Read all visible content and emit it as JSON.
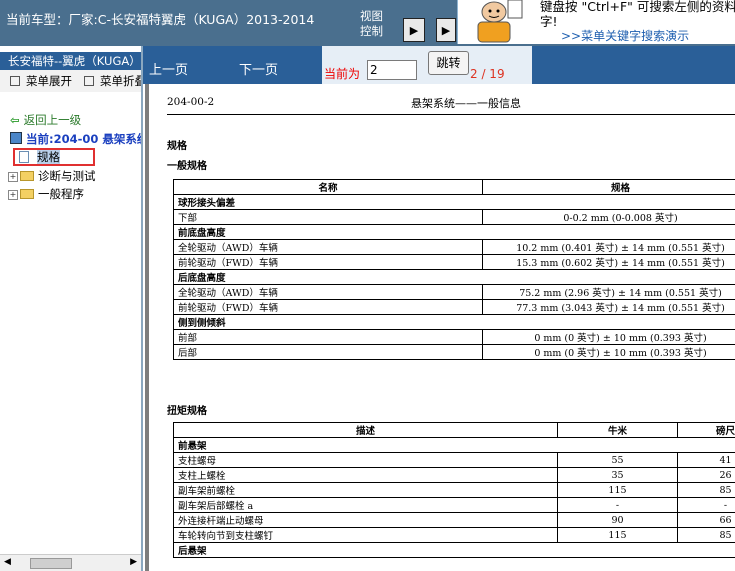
{
  "header": {
    "vehicle_label": "当前车型：厂家:C-长安福特翼虎（KUGA）2013-2014",
    "view_control_line1": "视图",
    "view_control_line2": "控制",
    "tip_line1": "键盘按 \"Ctrl+F\" 可搜索左侧的资料",
    "tip_line2": "字!",
    "tip_link": ">>菜单关键字搜索演示"
  },
  "sidebar": {
    "title": "长安福特--翼虎（KUGA）",
    "expand_menu": "菜单展开",
    "collapse_menu": "菜单折叠",
    "back": "返回上一级",
    "current": "当前:204-00 悬架系统",
    "items": [
      {
        "label": "规格",
        "selected": true
      },
      {
        "label": "诊断与测试"
      },
      {
        "label": "一般程序"
      }
    ]
  },
  "toolbar": {
    "prev": "上一页",
    "next": "下一页",
    "current_label": "当前为",
    "page_value": "2",
    "jump": "跳转",
    "page_count": "2 / 19"
  },
  "document": {
    "number": "204-00-2",
    "header": "悬架系统——一般信息",
    "section": "规格",
    "subsection1": "一般规格",
    "table1": {
      "headers": [
        "名称",
        "规格"
      ],
      "rows": [
        {
          "section": "球形接头偏差"
        },
        {
          "name": "下部",
          "spec": "0-0.2 mm (0-0.008 英寸)"
        },
        {
          "section": "前底盘高度"
        },
        {
          "name": "全轮驱动（AWD）车辆",
          "spec": "10.2 mm (0.401 英寸) ± 14 mm (0.551  英寸)"
        },
        {
          "name": "前轮驱动（FWD）车辆",
          "spec": "15.3 mm (0.602 英寸) ± 14 mm (0.551 英寸)"
        },
        {
          "section": "后底盘高度"
        },
        {
          "name": "全轮驱动（AWD）车辆",
          "spec": "75.2 mm (2.96 英寸) ± 14 mm (0.551 英寸)"
        },
        {
          "name": "前轮驱动（FWD）车辆",
          "spec": "77.3 mm (3.043 英寸) ± 14 mm (0.551 英寸)"
        },
        {
          "section": "侧到侧倾斜"
        },
        {
          "name": "前部",
          "spec": "0 mm (0 英寸) ± 10 mm (0.393 英寸)"
        },
        {
          "name": "后部",
          "spec": "0 mm (0 英寸) ± 10 mm (0.393 英寸)"
        }
      ]
    },
    "subsection2": "扭矩规格",
    "table2": {
      "headers": [
        "描述",
        "牛米",
        "磅尺"
      ],
      "rows": [
        {
          "section": "前悬架"
        },
        {
          "desc": "支柱螺母",
          "nm": "55",
          "lbft": "41"
        },
        {
          "desc": "支柱上螺栓",
          "nm": "35",
          "lbft": "26"
        },
        {
          "desc": "副车架前螺栓",
          "nm": "115",
          "lbft": "85"
        },
        {
          "desc": "副车架后部螺栓 a",
          "nm": "-",
          "lbft": "-"
        },
        {
          "desc": "外连接杆端止动螺母",
          "nm": "90",
          "lbft": "66"
        },
        {
          "desc": "车轮转向节到支柱螺钉",
          "nm": "115",
          "lbft": "85"
        },
        {
          "section": "后悬架"
        }
      ]
    }
  }
}
